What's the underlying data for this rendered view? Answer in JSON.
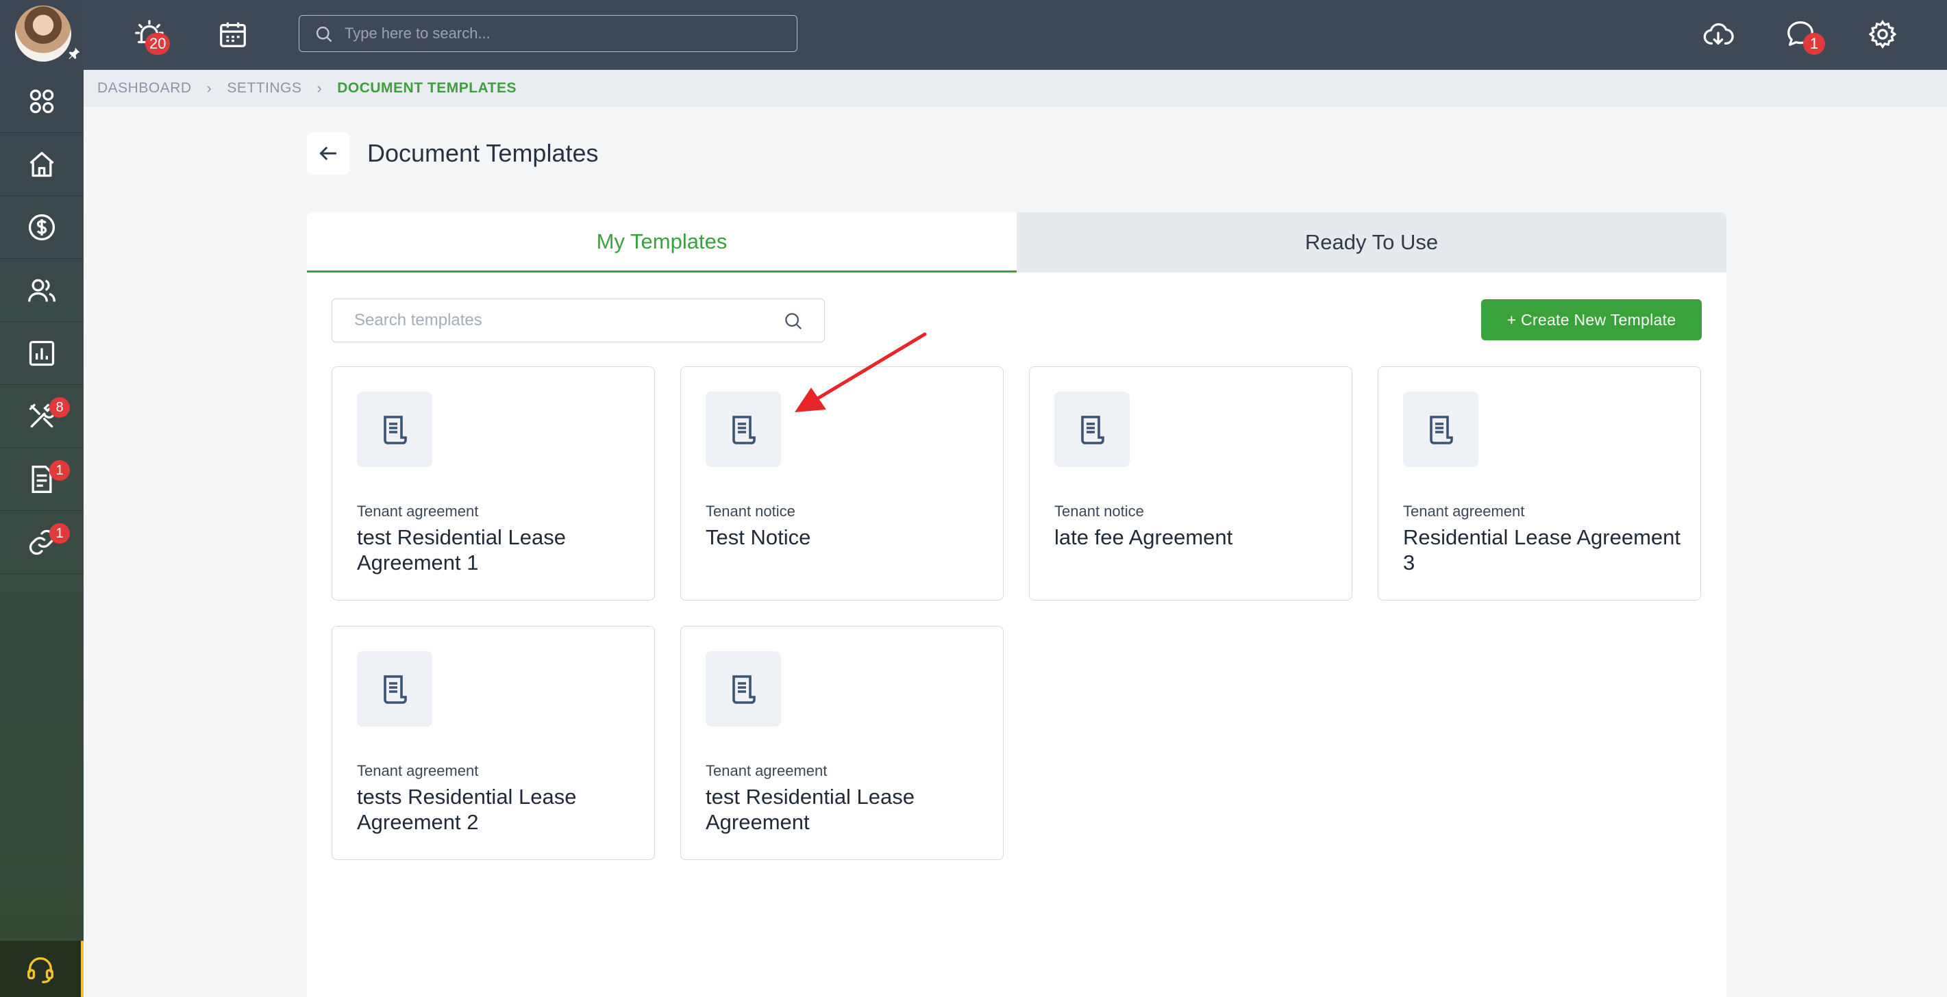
{
  "topbar": {
    "notifications_badge": "20",
    "search_placeholder": "Type here to search...",
    "messages_badge": "1"
  },
  "sidebar": {
    "items": [
      {
        "name": "apps",
        "badge": ""
      },
      {
        "name": "home",
        "badge": ""
      },
      {
        "name": "payments",
        "badge": ""
      },
      {
        "name": "people",
        "badge": ""
      },
      {
        "name": "reports",
        "badge": ""
      },
      {
        "name": "maintenance",
        "badge": "8"
      },
      {
        "name": "documents",
        "badge": "1"
      },
      {
        "name": "links",
        "badge": "1"
      }
    ]
  },
  "breadcrumb": {
    "items": [
      "DASHBOARD",
      "SETTINGS",
      "DOCUMENT TEMPLATES"
    ]
  },
  "page": {
    "title": "Document Templates"
  },
  "tabs": {
    "my_templates": "My Templates",
    "ready_to_use": "Ready To Use"
  },
  "templates_search": {
    "placeholder": "Search templates"
  },
  "create_button": "+ Create New Template",
  "templates": [
    {
      "type": "Tenant agreement",
      "name": "test Residential Lease Agreement 1"
    },
    {
      "type": "Tenant notice",
      "name": "Test Notice"
    },
    {
      "type": "Tenant notice",
      "name": "late fee Agreement"
    },
    {
      "type": "Tenant agreement",
      "name": "Residential Lease Agreement 3"
    },
    {
      "type": "Tenant agreement",
      "name": "tests Residential Lease Agreement 2"
    },
    {
      "type": "Tenant agreement",
      "name": "test Residential Lease Agreement"
    }
  ],
  "colors": {
    "accent_green": "#3aa23a",
    "badge_red": "#e03a3a",
    "annotation_arrow": "#e8262a"
  }
}
